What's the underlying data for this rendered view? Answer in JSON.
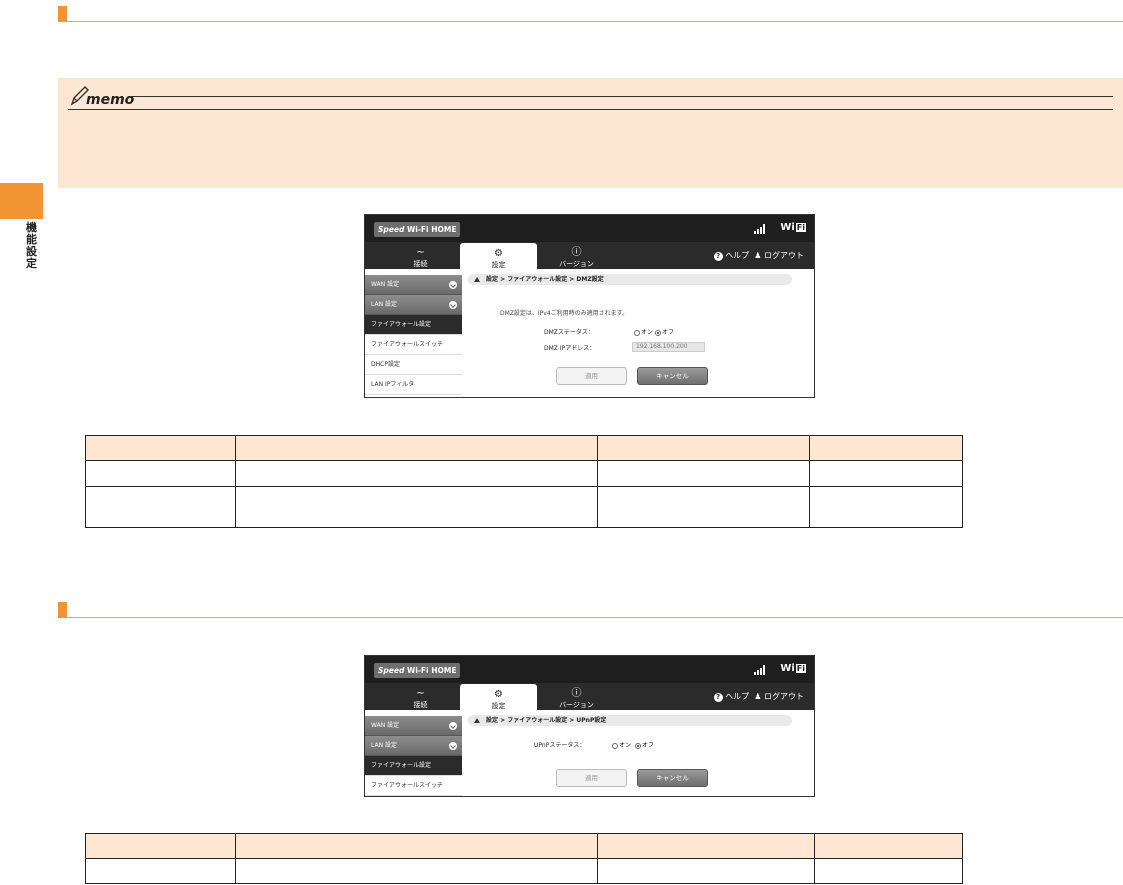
{
  "side_label": "機能設定",
  "memo": {
    "label": "memo"
  },
  "router_common": {
    "logo_bold_italic": "Speed",
    "logo_rest": "Wi-Fi HOME",
    "wifi_label": "Wi",
    "wifi_box": "Fi",
    "tabs": [
      {
        "label": "接続",
        "icon": "wifi-icon"
      },
      {
        "label": "設定",
        "icon": "gear-icon"
      },
      {
        "label": "バージョン",
        "icon": "info-icon"
      }
    ],
    "help": "ヘルプ",
    "logout": "ログアウト",
    "apply_button": "適用",
    "cancel_button": "キャンセル",
    "colors": {
      "accent": "#f39433",
      "memo_bg": "#fde7d3",
      "router_dark": "#1e1e1e"
    }
  },
  "router1": {
    "sidebar": [
      "WAN 設定",
      "LAN 設定",
      "ファイアウォール設定",
      "ファイアウォールスイッチ",
      "DHCP設定",
      "LAN IPフィルタ"
    ],
    "breadcrumb": "設定 > ファイアウォール設定 > DMZ設定",
    "note": "DMZ設定は、IPv4ご利用時のみ適用されます。",
    "status_label": "DMZステータス：",
    "radio_on": "オン",
    "radio_off": "オフ",
    "ip_label": "DMZ IPアドレス：",
    "ip_value": "192.168.100.200"
  },
  "router2": {
    "sidebar": [
      "WAN 設定",
      "LAN 設定",
      "ファイアウォール設定",
      "ファイアウォールスイッチ"
    ],
    "breadcrumb": "設定 > ファイアウォール設定 > UPnP設定",
    "status_label": "UPnPステータス：",
    "radio_on": "オン",
    "radio_off": "オフ"
  }
}
